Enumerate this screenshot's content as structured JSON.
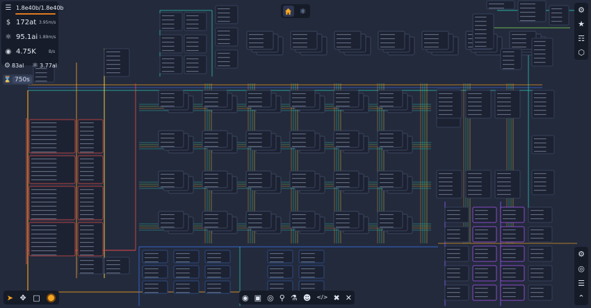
{
  "resources": {
    "storage": "1.8e40b/1.8e40b",
    "money": {
      "value": "172at",
      "rate": "3.95m/s",
      "icon": "dollar-icon"
    },
    "research": {
      "value": "95.1ai",
      "rate": "1.89m/s",
      "icon": "atom-icon"
    },
    "processing": {
      "value": "4.75K",
      "rate": "B/s",
      "icon": "cpu-icon"
    },
    "stat_a": {
      "value": "83al",
      "icon": "gear-icon"
    },
    "stat_b": {
      "value": "3.77al",
      "icon": "atom-icon"
    },
    "timer": {
      "value": "750s",
      "icon": "hourglass-icon"
    }
  },
  "top_nav": [
    {
      "name": "home-button",
      "icon": "home-icon",
      "active": true
    },
    {
      "name": "research-button",
      "icon": "atom-icon",
      "active": false
    }
  ],
  "right_top_menu": [
    "settings-icon",
    "trophy-icon",
    "book-icon",
    "hexagon-icon"
  ],
  "right_bottom_menu": [
    "blueprint-icon",
    "target-icon",
    "database-icon",
    "collapse-icon"
  ],
  "tools": [
    "pointer-icon",
    "move-icon",
    "select-box-icon",
    "record-icon"
  ],
  "bottom_bar": [
    "globe-icon",
    "chip-icon",
    "process-icon",
    "microscope-icon",
    "flask-icon",
    "user-icon",
    "code-icon",
    "tools-icon",
    "close-icon"
  ],
  "colors": {
    "background": "#232a3c",
    "panel": "#161b28",
    "accent": "#f5a623",
    "wire_orange": "#f0a020",
    "wire_teal": "#2bd4c0",
    "wire_green": "#7ed957",
    "wire_red": "#e04b4b",
    "wire_blue": "#3a6fe0",
    "wire_purple": "#8a5cf5",
    "wire_yellow": "#f2d14b"
  }
}
